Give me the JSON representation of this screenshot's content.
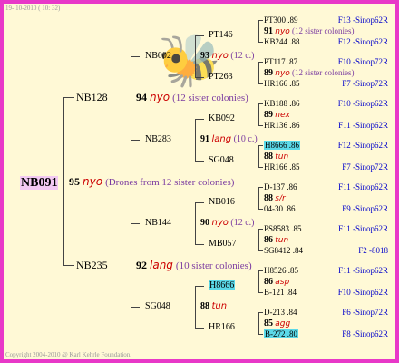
{
  "date": "19- 10-2010 ( 10: 32)",
  "copyright": "Copyright 2004-2010 @ Karl Kehrle Foundation.",
  "root": {
    "id": "NB091",
    "year": "95",
    "line": "nyo",
    "note": "(Drones from 12 sister colonies)"
  },
  "gen1": [
    {
      "id": "NB128",
      "year": "94",
      "line": "nyo",
      "note": "(12 sister colonies)"
    },
    {
      "id": "NB235",
      "year": "92",
      "line": "lang",
      "note": "(10 sister colonies)"
    }
  ],
  "gen2": [
    {
      "id": "NB002",
      "year": "93",
      "line": "nyo",
      "note": "(12 c.)"
    },
    {
      "id": "NB283",
      "year": "91",
      "line": "lang",
      "note": "(10 c.)"
    },
    {
      "id": "NB144",
      "year": "90",
      "line": "nyo",
      "note": "(12 c.)"
    },
    {
      "id": "SG048",
      "year": "88",
      "line": "tun",
      "note": ""
    }
  ],
  "gen3": [
    {
      "top": "PT146",
      "year": "93",
      "line": "nyo",
      "note": "(12 c.)",
      "bottom": "PT263"
    },
    {
      "top": "KB092",
      "year": "91",
      "line": "lang",
      "note": "(10 c.)",
      "bottom": "SG048"
    },
    {
      "top": "NB016",
      "year": "90",
      "line": "nyo",
      "note": "(12 c.)",
      "bottom": "MB057"
    },
    {
      "top": "H8666",
      "year": "88",
      "line": "tun",
      "note": "",
      "bottom": "HR166"
    }
  ],
  "gen4": [
    {
      "top": "PT300 .89",
      "top_src": "F13 -Sinop62R",
      "year": "91",
      "line": "nyo",
      "note": "(12 sister colonies)",
      "bottom": "KB244 .88",
      "bottom_src": "F12 -Sinop62R"
    },
    {
      "top": "PT117 .87",
      "top_src": "F10 -Sinop72R",
      "year": "89",
      "line": "nyo",
      "note": "(12 sister colonies)",
      "bottom": "HR166 .85",
      "bottom_src": "F7 -Sinop72R"
    },
    {
      "top": "KB188 .86",
      "top_src": "F10 -Sinop62R",
      "year": "89",
      "line": "nex",
      "note": "",
      "bottom": "HR136 .86",
      "bottom_src": "F11 -Sinop62R"
    },
    {
      "top": "H8666 .86",
      "top_src": "F12 -Sinop62R",
      "year": "88",
      "line": "tun",
      "note": "",
      "bottom": "HR166 .85",
      "bottom_src": "F7 -Sinop72R"
    },
    {
      "top": "D-137 .86",
      "top_src": "F11 -Sinop62R",
      "year": "88",
      "line": "s/r",
      "note": "",
      "bottom": "04-30 .86",
      "bottom_src": "F9 -Sinop62R"
    },
    {
      "top": "PS8583 .85",
      "top_src": "F11 -Sinop62R",
      "year": "86",
      "line": "tun",
      "note": "",
      "bottom": "SG8412 .84",
      "bottom_src": "F2 -8018"
    },
    {
      "top": "H8526 .85",
      "top_src": "F11 -Sinop62R",
      "year": "86",
      "line": "asp",
      "note": "",
      "bottom": "B-121 .84",
      "bottom_src": "F10 -Sinop62R"
    },
    {
      "top": "D-213 .84",
      "top_src": "F6 -Sinop72R",
      "year": "85",
      "line": "agg",
      "note": "",
      "bottom": "B-272 .80",
      "bottom_src": "F8 -Sinop62R"
    }
  ]
}
